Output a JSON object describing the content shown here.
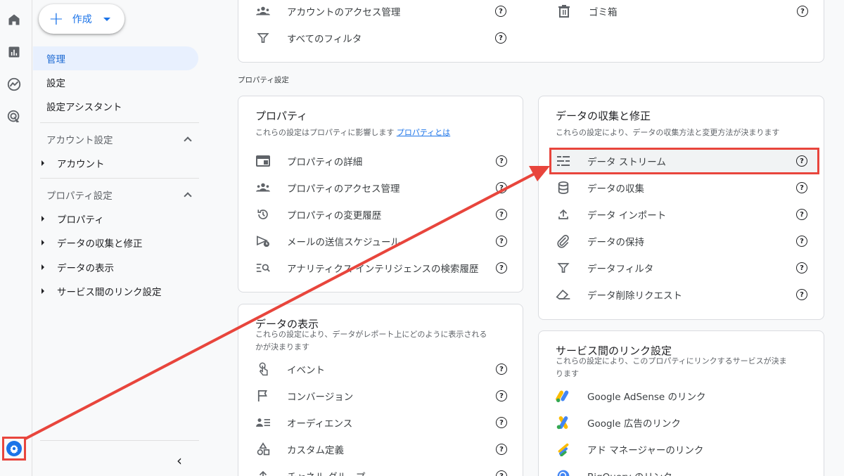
{
  "create": {
    "label": "作成"
  },
  "sidebar": {
    "admin": "管理",
    "settings": "設定",
    "assistant": "設定アシスタント",
    "account_section": "アカウント設定",
    "account_items": [
      "アカウント"
    ],
    "property_section": "プロパティ設定",
    "property_items": [
      "プロパティ",
      "データの収集と修正",
      "データの表示",
      "サービス間のリンク設定"
    ]
  },
  "top_card": {
    "left": [
      {
        "label": "アカウントのアクセス管理",
        "icon": "people-icon"
      },
      {
        "label": "すべてのフィルタ",
        "icon": "filter-icon"
      }
    ],
    "right": [
      {
        "label": "ゴミ箱",
        "icon": "trash-icon"
      }
    ]
  },
  "property_settings_label": "プロパティ設定",
  "property_card": {
    "title": "プロパティ",
    "desc": "これらの設定はプロパティに影響します",
    "link": "プロパティとは",
    "items": [
      "プロパティの詳細",
      "プロパティのアクセス管理",
      "プロパティの変更履歴",
      "メールの送信スケジュール",
      "アナリティクス インテリジェンスの検索履歴"
    ]
  },
  "collection_card": {
    "title": "データの収集と修正",
    "desc": "これらの設定により、データの収集方法と変更方法が決まります",
    "items": [
      "データ ストリーム",
      "データの収集",
      "データ インポート",
      "データの保持",
      "データフィルタ",
      "データ削除リクエスト"
    ]
  },
  "display_card": {
    "title": "データの表示",
    "desc_line1": "これらの設定により、データがレポート上にどのように表示される",
    "desc_line2": "かが決まります",
    "items": [
      "イベント",
      "コンバージョン",
      "オーディエンス",
      "カスタム定義",
      "チャネル グループ"
    ]
  },
  "link_card": {
    "title": "サービス間のリンク設定",
    "desc_line1": "これらの設定により、このプロパティにリンクするサービスが決ま",
    "desc_line2": "ります",
    "items": [
      "Google AdSense のリンク",
      "Google 広告のリンク",
      "アド マネージャーのリンク",
      "BigQuery のリンク"
    ]
  },
  "help_glyph": "?",
  "accent_color": "#e8453c"
}
